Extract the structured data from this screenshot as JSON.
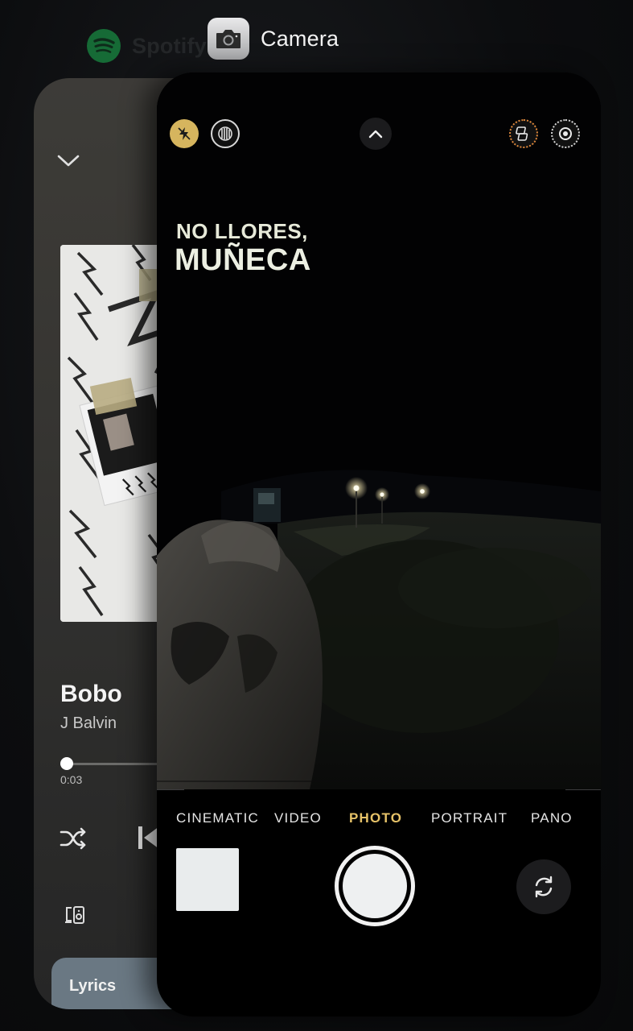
{
  "switcher": {
    "spotify_app_name": "Spotify",
    "camera_app_name": "Camera"
  },
  "spotify": {
    "track_title": "Bobo",
    "artist": "J Balvin",
    "elapsed": "0:03",
    "progress_fraction": 0.03,
    "lyrics_label": "Lyrics",
    "icons": [
      "chevron-down-icon",
      "shuffle-icon",
      "previous-track-icon",
      "devices-icon"
    ]
  },
  "camera": {
    "overlay_text_line1": "NO LLORES,",
    "overlay_text_line2": "MUÑECA",
    "modes": [
      "CINEMATIC",
      "VIDEO",
      "PHOTO",
      "PORTRAIT",
      "PANO"
    ],
    "active_mode": "PHOTO",
    "icons": [
      "flash-icon",
      "live-photo-icon",
      "expand-controls-icon",
      "photographic-styles-icon",
      "live-photo-toggle-icon",
      "camera-flip-icon"
    ],
    "colors": {
      "accent_yellow": "#e6c268",
      "flash_active": "#d6b55e",
      "styles_orange": "#e0883a"
    }
  }
}
